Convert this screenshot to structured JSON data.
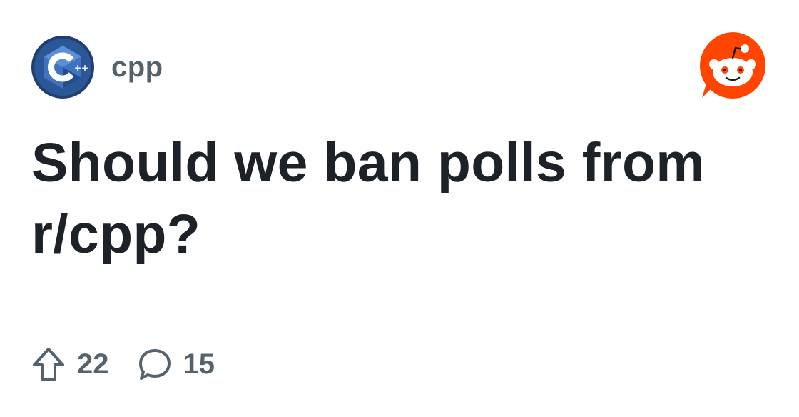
{
  "subreddit": {
    "name": "cpp",
    "avatar_icon": "cpp-logo-icon"
  },
  "post": {
    "title": "Should we ban polls from r/cpp?"
  },
  "stats": {
    "upvotes": "22",
    "upvote_icon": "upvote-arrow-icon",
    "comments": "15",
    "comment_icon": "comment-bubble-icon"
  },
  "branding": {
    "logo_icon": "reddit-logo-icon"
  },
  "colors": {
    "title": "#1c2228",
    "meta_text": "#56626b",
    "reddit_orange": "#ff4500",
    "cpp_blue": "#1b4d8f"
  }
}
